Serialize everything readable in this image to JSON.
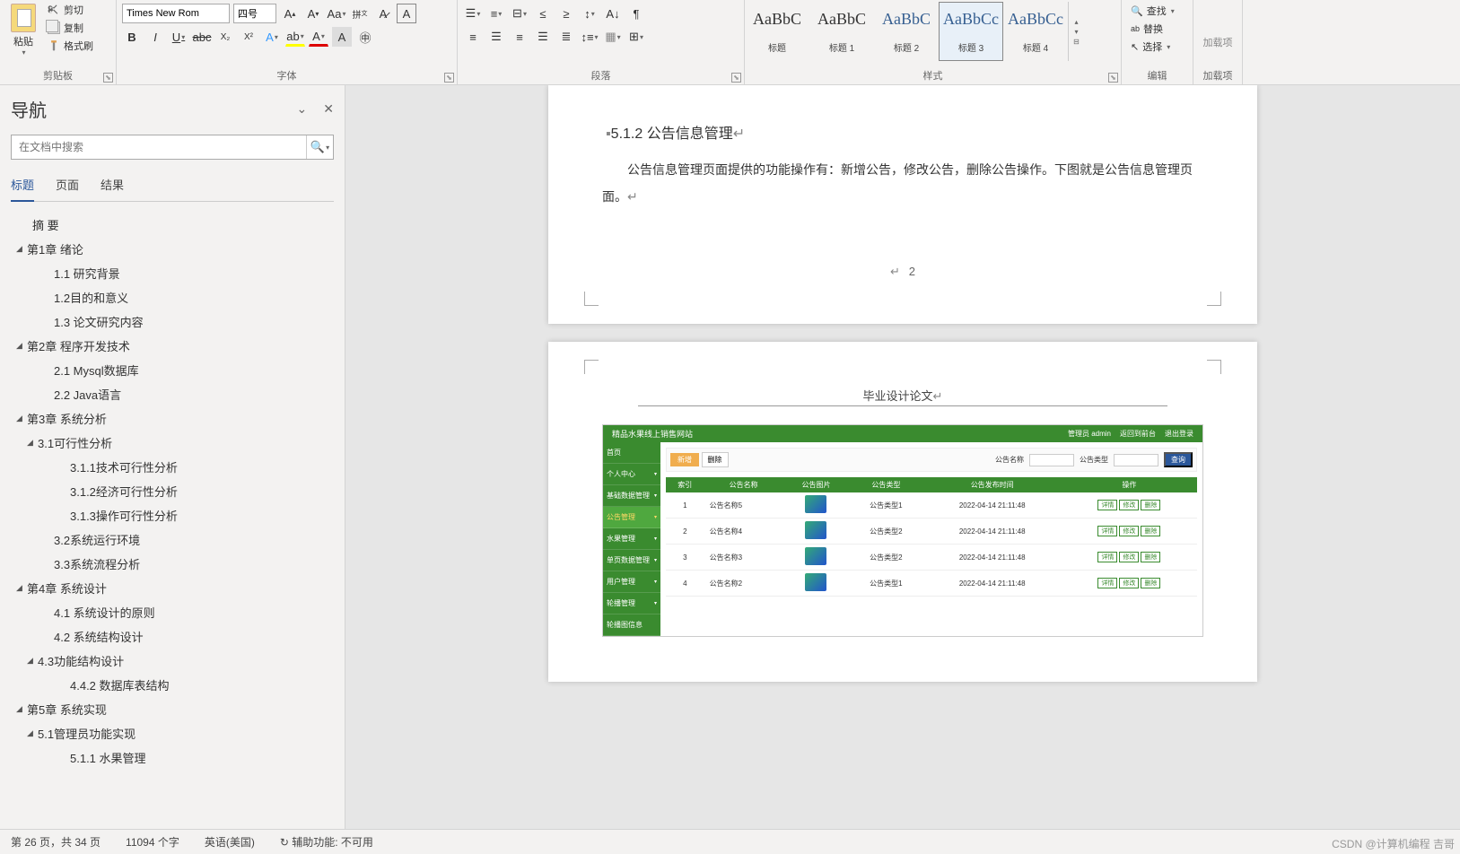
{
  "ribbon": {
    "clipboard": {
      "label": "剪贴板",
      "paste": "粘贴",
      "cut": "剪切",
      "copy": "复制",
      "format_painter": "格式刷"
    },
    "font": {
      "label": "字体",
      "font_name": "Times New Rom",
      "font_size": "四号"
    },
    "paragraph": {
      "label": "段落"
    },
    "styles": {
      "label": "样式",
      "items": [
        {
          "preview": "AaBbC",
          "name": "标题"
        },
        {
          "preview": "AaBbC",
          "name": "标题 1"
        },
        {
          "preview": "AaBbC",
          "name": "标题 2"
        },
        {
          "preview": "AaBbCc",
          "name": "标题 3"
        },
        {
          "preview": "AaBbCc",
          "name": "标题 4"
        }
      ],
      "selected_index": 3
    },
    "editing": {
      "label": "编辑",
      "find": "查找",
      "replace": "替换",
      "select": "选择"
    },
    "addins": {
      "label": "加载项",
      "button": "加载项"
    }
  },
  "nav": {
    "title": "导航",
    "search_placeholder": "在文档中搜索",
    "tabs": {
      "headings": "标题",
      "pages": "页面",
      "results": "结果"
    },
    "tree": [
      {
        "lv": 0,
        "caret": false,
        "text": "摘  要"
      },
      {
        "lv": 1,
        "caret": true,
        "text": "第1章 绪论"
      },
      {
        "lv": 2,
        "caret": false,
        "text": "1.1 研究背景"
      },
      {
        "lv": 2,
        "caret": false,
        "text": "1.2目的和意义"
      },
      {
        "lv": 2,
        "caret": false,
        "text": "1.3 论文研究内容"
      },
      {
        "lv": 1,
        "caret": true,
        "text": "第2章 程序开发技术"
      },
      {
        "lv": 2,
        "caret": false,
        "text": "2.1 Mysql数据库"
      },
      {
        "lv": 2,
        "caret": false,
        "text": "2.2 Java语言"
      },
      {
        "lv": 1,
        "caret": true,
        "text": "第3章 系统分析"
      },
      {
        "lv": 3,
        "caret": true,
        "text": "3.1可行性分析"
      },
      {
        "lv": 4,
        "caret": false,
        "text": "3.1.1技术可行性分析"
      },
      {
        "lv": 4,
        "caret": false,
        "text": "3.1.2经济可行性分析"
      },
      {
        "lv": 4,
        "caret": false,
        "text": "3.1.3操作可行性分析"
      },
      {
        "lv": 2,
        "caret": false,
        "text": "3.2系统运行环境"
      },
      {
        "lv": 2,
        "caret": false,
        "text": "3.3系统流程分析"
      },
      {
        "lv": 1,
        "caret": true,
        "text": "第4章 系统设计"
      },
      {
        "lv": 2,
        "caret": false,
        "text": "4.1 系统设计的原则"
      },
      {
        "lv": 2,
        "caret": false,
        "text": "4.2 系统结构设计"
      },
      {
        "lv": 3,
        "caret": true,
        "text": "4.3功能结构设计"
      },
      {
        "lv": 4,
        "caret": false,
        "text": "4.4.2 数据库表结构"
      },
      {
        "lv": 1,
        "caret": true,
        "text": "第5章 系统实现"
      },
      {
        "lv": 3,
        "caret": true,
        "text": "5.1管理员功能实现"
      },
      {
        "lv": 4,
        "caret": false,
        "text": "5.1.1 水果管理"
      }
    ]
  },
  "doc": {
    "page1": {
      "heading": "5.1.2  公告信息管理",
      "body": "公告信息管理页面提供的功能操作有：新增公告，修改公告，删除公告操作。下图就是公告信息管理页面。",
      "page_number": "2"
    },
    "page2": {
      "header": "毕业设计论文"
    }
  },
  "embed": {
    "title": "精品水果线上销售网站",
    "header_right": [
      "管理员 admin",
      "返回到前台",
      "退出登录"
    ],
    "sidebar": [
      "首页",
      "个人中心",
      "基础数据管理",
      "公告管理",
      "水果管理",
      "单页数据管理",
      "用户管理",
      "轮播管理",
      "轮播图信息"
    ],
    "sidebar_active_index": 3,
    "filters": {
      "f1_label": "公告名称",
      "f2_label": "公告类型",
      "search": "查询"
    },
    "buttons": {
      "add": "新增",
      "delete": "删除"
    },
    "table": {
      "headers": [
        "索引",
        "公告名称",
        "公告图片",
        "公告类型",
        "公告发布时间",
        "操作"
      ],
      "rows": [
        {
          "idx": "1",
          "name": "公告名称5",
          "type": "公告类型1",
          "time": "2022-04-14 21:11:48"
        },
        {
          "idx": "2",
          "name": "公告名称4",
          "type": "公告类型2",
          "time": "2022-04-14 21:11:48"
        },
        {
          "idx": "3",
          "name": "公告名称3",
          "type": "公告类型2",
          "time": "2022-04-14 21:11:48"
        },
        {
          "idx": "4",
          "name": "公告名称2",
          "type": "公告类型1",
          "time": "2022-04-14 21:11:48"
        }
      ],
      "actions": [
        "详情",
        "修改",
        "删除"
      ]
    }
  },
  "status": {
    "page": "第 26 页，共 34 页",
    "words": "11094 个字",
    "lang": "英语(美国)",
    "accessibility": "辅助功能: 不可用"
  },
  "watermark": "CSDN @计算机编程 吉哥"
}
